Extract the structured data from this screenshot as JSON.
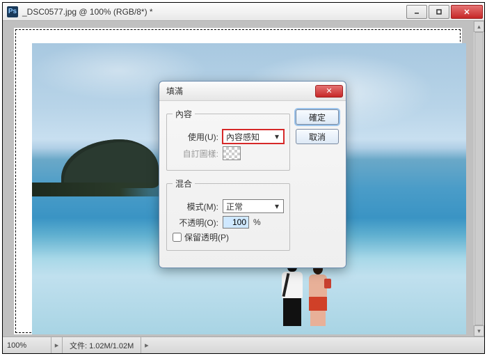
{
  "window": {
    "title": "_DSC0577.jpg @ 100% (RGB/8*) *",
    "icon_label": "Ps"
  },
  "statusbar": {
    "zoom": "100%",
    "filesize_label": "文件:",
    "filesize_value": "1.02M/1.02M"
  },
  "dialog": {
    "title": "填滿",
    "close_glyph": "✕",
    "ok_label": "確定",
    "cancel_label": "取消",
    "content_group": "內容",
    "use_label": "使用(U):",
    "use_value": "內容感知",
    "custom_pattern_label": "自訂圖樣:",
    "blend_group": "混合",
    "mode_label": "模式(M):",
    "mode_value": "正常",
    "opacity_label": "不透明(O):",
    "opacity_value": "100",
    "opacity_unit": "%",
    "preserve_label": "保留透明(P)"
  }
}
